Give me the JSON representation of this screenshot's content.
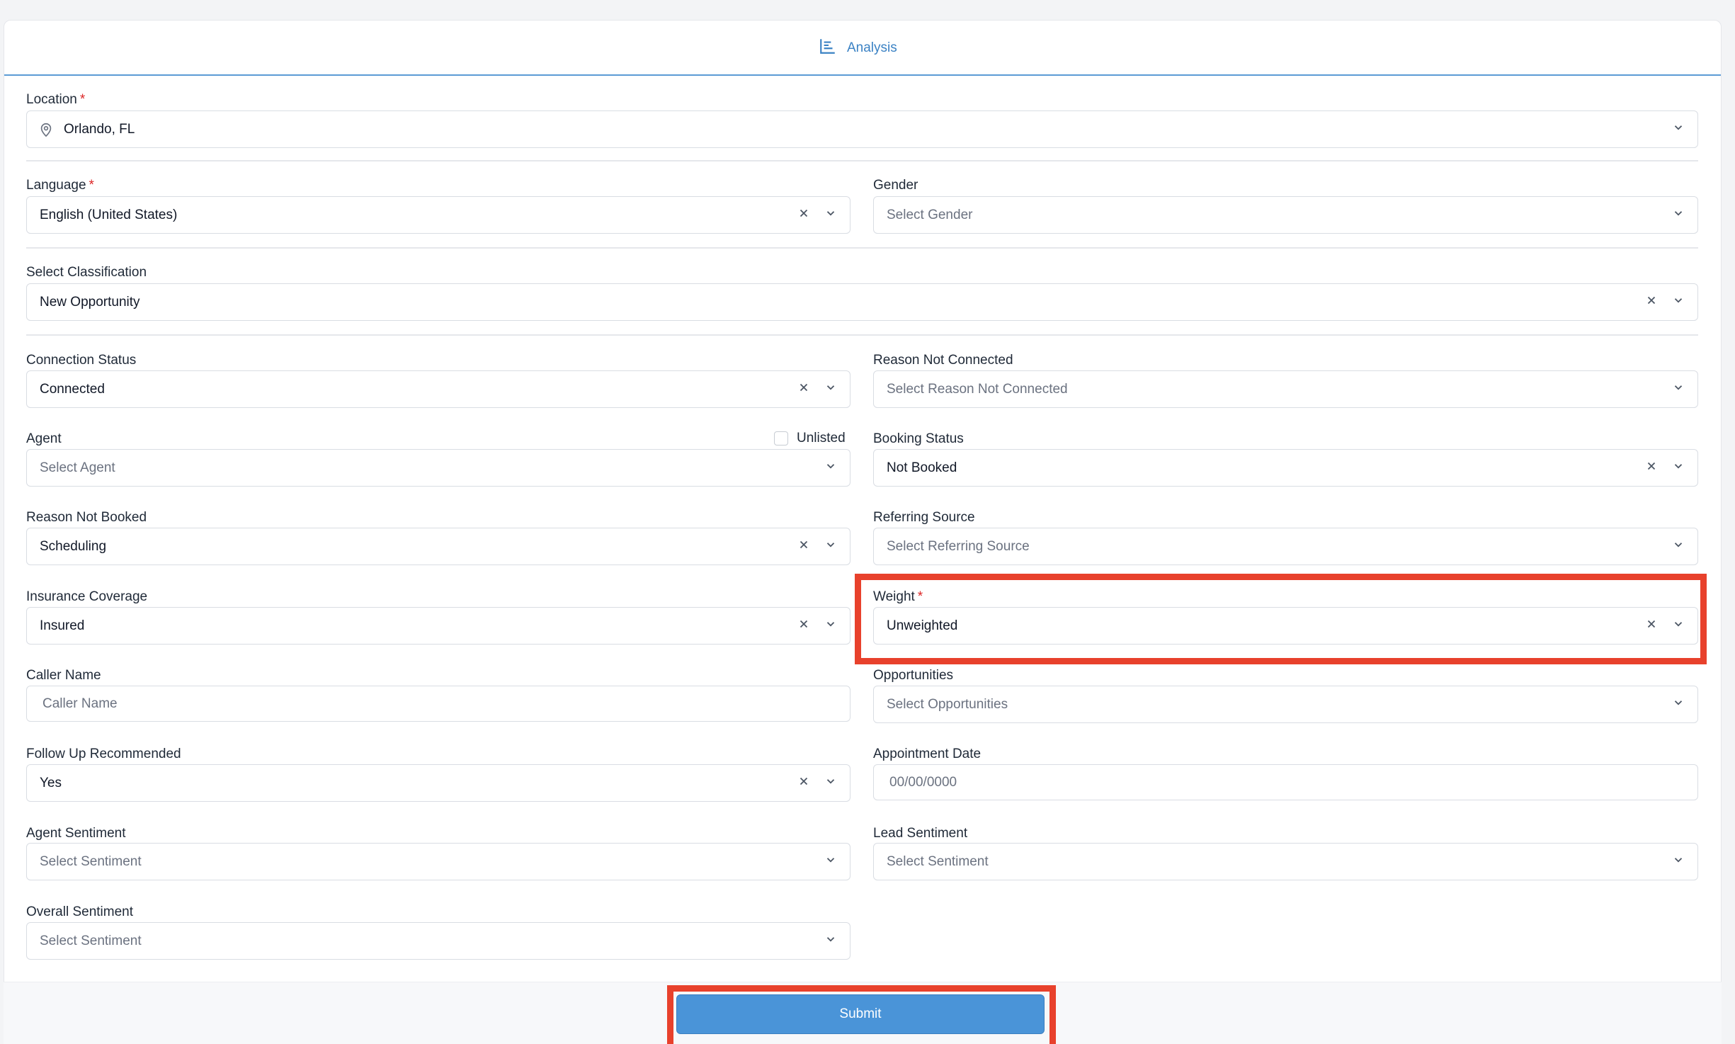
{
  "tab": {
    "label": "Analysis",
    "icon": "chart-bar-icon"
  },
  "fields": {
    "location": {
      "label": "Location",
      "required": "*",
      "value": "Orlando, FL",
      "icon": "map-pin-icon"
    },
    "language": {
      "label": "Language",
      "required": "*",
      "value": "English (United States)"
    },
    "gender": {
      "label": "Gender",
      "placeholder": "Select Gender"
    },
    "classification": {
      "label": "Select Classification",
      "value": "New Opportunity"
    },
    "connection_status": {
      "label": "Connection Status",
      "value": "Connected"
    },
    "reason_not_connected": {
      "label": "Reason Not Connected",
      "placeholder": "Select Reason Not Connected"
    },
    "agent": {
      "label": "Agent",
      "placeholder": "Select Agent",
      "unlisted_label": "Unlisted"
    },
    "booking_status": {
      "label": "Booking Status",
      "value": "Not Booked"
    },
    "reason_not_booked": {
      "label": "Reason Not Booked",
      "value": "Scheduling"
    },
    "referring_source": {
      "label": "Referring Source",
      "placeholder": "Select Referring Source"
    },
    "insurance_coverage": {
      "label": "Insurance Coverage",
      "value": "Insured"
    },
    "weight": {
      "label": "Weight",
      "required": "*",
      "value": "Unweighted"
    },
    "caller_name": {
      "label": "Caller Name",
      "placeholder": "Caller Name"
    },
    "opportunities": {
      "label": "Opportunities",
      "placeholder": "Select Opportunities"
    },
    "follow_up": {
      "label": "Follow Up Recommended",
      "value": "Yes"
    },
    "appointment_date": {
      "label": "Appointment Date",
      "placeholder": "00/00/0000"
    },
    "agent_sentiment": {
      "label": "Agent Sentiment",
      "placeholder": "Select Sentiment"
    },
    "lead_sentiment": {
      "label": "Lead Sentiment",
      "placeholder": "Select Sentiment"
    },
    "overall_sentiment": {
      "label": "Overall Sentiment",
      "placeholder": "Select Sentiment"
    }
  },
  "submit_label": "Submit",
  "colors": {
    "accent": "#4a94d8",
    "highlight": "#e8412c",
    "required": "#dc2626"
  }
}
